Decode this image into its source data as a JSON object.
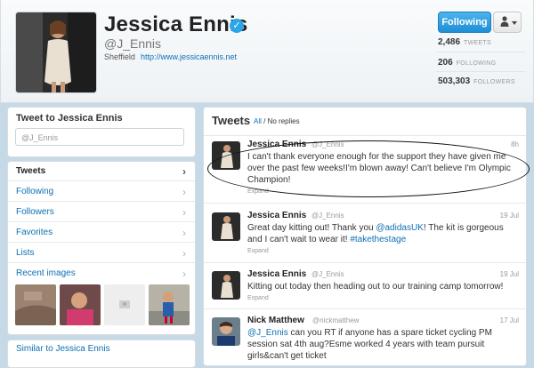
{
  "profile": {
    "name": "Jessica Ennis",
    "handle": "@J_Ennis",
    "location": "Sheffield",
    "website": "http://www.jessicaennis.net",
    "verified_icon": "verified-check-icon"
  },
  "actions": {
    "follow_label": "Following",
    "user_menu_icon": "person-icon"
  },
  "stats": [
    {
      "value": "2,486",
      "label": "TWEETS"
    },
    {
      "value": "206",
      "label": "FOLLOWING"
    },
    {
      "value": "503,303",
      "label": "FOLLOWERS"
    }
  ],
  "tweet_to": {
    "title": "Tweet to Jessica Ennis",
    "placeholder": "@J_Ennis"
  },
  "nav": {
    "items": [
      {
        "label": "Tweets"
      },
      {
        "label": "Following"
      },
      {
        "label": "Followers"
      },
      {
        "label": "Favorites"
      },
      {
        "label": "Lists"
      },
      {
        "label": "Recent images"
      }
    ],
    "chevron": "›"
  },
  "similar": {
    "label": "Similar to Jessica Ennis"
  },
  "tweets_header": {
    "title": "Tweets",
    "all": "All",
    "sep": "/",
    "no_replies": "No replies"
  },
  "tweets": [
    {
      "author": "Jessica Ennis",
      "username": "@J_Ennis",
      "time": "8h",
      "text": "I can't thank everyone enough for the support they have given me over the past few weeks!I'm blown away! Can't believe I'm Olympic Champion!",
      "expand": "Expand"
    },
    {
      "author": "Jessica Ennis",
      "username": "@J_Ennis",
      "time": "19 Jul",
      "text_a": "Great day kitting out! Thank you ",
      "mention": "@adidasUK",
      "text_b": "! The kit is gorgeous and I can't wait to wear it! ",
      "hashtag": "#takethestage",
      "expand": "Expand"
    },
    {
      "author": "Jessica Ennis",
      "username": "@J_Ennis",
      "time": "19 Jul",
      "text": "Kitting out today then heading out to our training camp tomorrow!",
      "expand": "Expand"
    },
    {
      "author": "Nick Matthew",
      "username": "@nickmatthew",
      "time": "17 Jul",
      "mention": "@J_Ennis",
      "text": " can you RT if anyone has a spare ticket cycling PM session sat 4th aug?Esme worked 4 years with team pursuit girls&can't get ticket"
    }
  ],
  "colors": {
    "background": "#c6d9e6",
    "link": "#0f6fb3",
    "button": "#1f8fd6",
    "verified": "#2ba6e8"
  }
}
